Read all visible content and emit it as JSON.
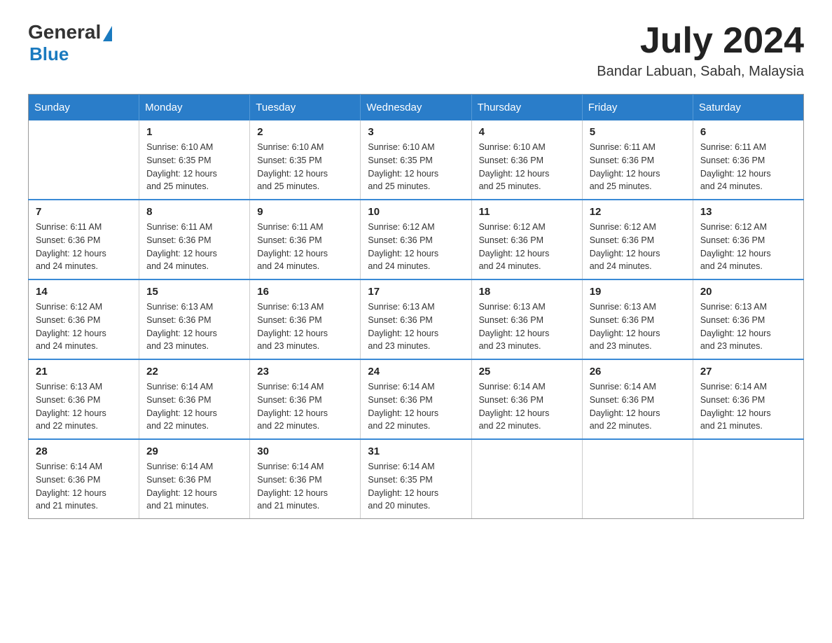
{
  "header": {
    "logo_general": "General",
    "logo_blue": "Blue",
    "month_title": "July 2024",
    "location": "Bandar Labuan, Sabah, Malaysia"
  },
  "days_of_week": [
    "Sunday",
    "Monday",
    "Tuesday",
    "Wednesday",
    "Thursday",
    "Friday",
    "Saturday"
  ],
  "weeks": [
    [
      {
        "day": "",
        "info": ""
      },
      {
        "day": "1",
        "info": "Sunrise: 6:10 AM\nSunset: 6:35 PM\nDaylight: 12 hours\nand 25 minutes."
      },
      {
        "day": "2",
        "info": "Sunrise: 6:10 AM\nSunset: 6:35 PM\nDaylight: 12 hours\nand 25 minutes."
      },
      {
        "day": "3",
        "info": "Sunrise: 6:10 AM\nSunset: 6:35 PM\nDaylight: 12 hours\nand 25 minutes."
      },
      {
        "day": "4",
        "info": "Sunrise: 6:10 AM\nSunset: 6:36 PM\nDaylight: 12 hours\nand 25 minutes."
      },
      {
        "day": "5",
        "info": "Sunrise: 6:11 AM\nSunset: 6:36 PM\nDaylight: 12 hours\nand 25 minutes."
      },
      {
        "day": "6",
        "info": "Sunrise: 6:11 AM\nSunset: 6:36 PM\nDaylight: 12 hours\nand 24 minutes."
      }
    ],
    [
      {
        "day": "7",
        "info": "Sunrise: 6:11 AM\nSunset: 6:36 PM\nDaylight: 12 hours\nand 24 minutes."
      },
      {
        "day": "8",
        "info": "Sunrise: 6:11 AM\nSunset: 6:36 PM\nDaylight: 12 hours\nand 24 minutes."
      },
      {
        "day": "9",
        "info": "Sunrise: 6:11 AM\nSunset: 6:36 PM\nDaylight: 12 hours\nand 24 minutes."
      },
      {
        "day": "10",
        "info": "Sunrise: 6:12 AM\nSunset: 6:36 PM\nDaylight: 12 hours\nand 24 minutes."
      },
      {
        "day": "11",
        "info": "Sunrise: 6:12 AM\nSunset: 6:36 PM\nDaylight: 12 hours\nand 24 minutes."
      },
      {
        "day": "12",
        "info": "Sunrise: 6:12 AM\nSunset: 6:36 PM\nDaylight: 12 hours\nand 24 minutes."
      },
      {
        "day": "13",
        "info": "Sunrise: 6:12 AM\nSunset: 6:36 PM\nDaylight: 12 hours\nand 24 minutes."
      }
    ],
    [
      {
        "day": "14",
        "info": "Sunrise: 6:12 AM\nSunset: 6:36 PM\nDaylight: 12 hours\nand 24 minutes."
      },
      {
        "day": "15",
        "info": "Sunrise: 6:13 AM\nSunset: 6:36 PM\nDaylight: 12 hours\nand 23 minutes."
      },
      {
        "day": "16",
        "info": "Sunrise: 6:13 AM\nSunset: 6:36 PM\nDaylight: 12 hours\nand 23 minutes."
      },
      {
        "day": "17",
        "info": "Sunrise: 6:13 AM\nSunset: 6:36 PM\nDaylight: 12 hours\nand 23 minutes."
      },
      {
        "day": "18",
        "info": "Sunrise: 6:13 AM\nSunset: 6:36 PM\nDaylight: 12 hours\nand 23 minutes."
      },
      {
        "day": "19",
        "info": "Sunrise: 6:13 AM\nSunset: 6:36 PM\nDaylight: 12 hours\nand 23 minutes."
      },
      {
        "day": "20",
        "info": "Sunrise: 6:13 AM\nSunset: 6:36 PM\nDaylight: 12 hours\nand 23 minutes."
      }
    ],
    [
      {
        "day": "21",
        "info": "Sunrise: 6:13 AM\nSunset: 6:36 PM\nDaylight: 12 hours\nand 22 minutes."
      },
      {
        "day": "22",
        "info": "Sunrise: 6:14 AM\nSunset: 6:36 PM\nDaylight: 12 hours\nand 22 minutes."
      },
      {
        "day": "23",
        "info": "Sunrise: 6:14 AM\nSunset: 6:36 PM\nDaylight: 12 hours\nand 22 minutes."
      },
      {
        "day": "24",
        "info": "Sunrise: 6:14 AM\nSunset: 6:36 PM\nDaylight: 12 hours\nand 22 minutes."
      },
      {
        "day": "25",
        "info": "Sunrise: 6:14 AM\nSunset: 6:36 PM\nDaylight: 12 hours\nand 22 minutes."
      },
      {
        "day": "26",
        "info": "Sunrise: 6:14 AM\nSunset: 6:36 PM\nDaylight: 12 hours\nand 22 minutes."
      },
      {
        "day": "27",
        "info": "Sunrise: 6:14 AM\nSunset: 6:36 PM\nDaylight: 12 hours\nand 21 minutes."
      }
    ],
    [
      {
        "day": "28",
        "info": "Sunrise: 6:14 AM\nSunset: 6:36 PM\nDaylight: 12 hours\nand 21 minutes."
      },
      {
        "day": "29",
        "info": "Sunrise: 6:14 AM\nSunset: 6:36 PM\nDaylight: 12 hours\nand 21 minutes."
      },
      {
        "day": "30",
        "info": "Sunrise: 6:14 AM\nSunset: 6:36 PM\nDaylight: 12 hours\nand 21 minutes."
      },
      {
        "day": "31",
        "info": "Sunrise: 6:14 AM\nSunset: 6:35 PM\nDaylight: 12 hours\nand 20 minutes."
      },
      {
        "day": "",
        "info": ""
      },
      {
        "day": "",
        "info": ""
      },
      {
        "day": "",
        "info": ""
      }
    ]
  ]
}
